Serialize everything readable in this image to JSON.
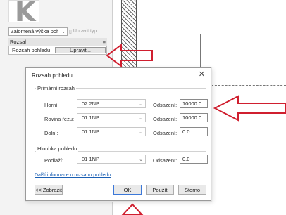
{
  "properties": {
    "type_selector": "Zalomená výška poř",
    "edit_type": "Upravit typ",
    "category": "Rozsah",
    "view_range_label": "Rozsah pohledu",
    "edit_button": "Upravit..."
  },
  "dialog": {
    "title": "Rozsah pohledu",
    "primary_title": "Primární rozsah",
    "depth_title": "Hloubka pohledu",
    "offset_label": "Odsazení:",
    "rows": [
      {
        "label": "Horní:",
        "level": "02 2NP",
        "offset": "10000.0"
      },
      {
        "label": "Rovina řezu:",
        "level": "01 1NP",
        "offset": "10000.0"
      },
      {
        "label": "Dolní:",
        "level": "01 1NP",
        "offset": "0.0"
      }
    ],
    "depth_row": {
      "label": "Podlaží:",
      "level": "01 1NP",
      "offset": "0.0"
    },
    "more_info_link": "Další informace o rozsahu pohledu",
    "buttons": {
      "show": "<< Zobrazit",
      "ok": "OK",
      "apply": "Použít",
      "cancel": "Storno"
    }
  },
  "colors": {
    "arrow": "#d01f2f",
    "link": "#1a5fb4"
  }
}
